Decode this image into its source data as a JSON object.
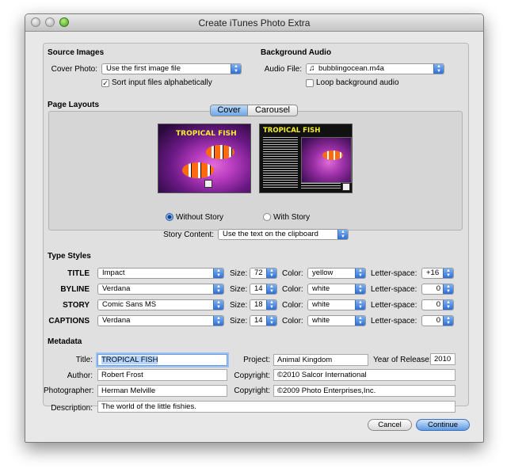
{
  "window": {
    "title": "Create iTunes Photo Extra"
  },
  "source_images": {
    "heading": "Source Images",
    "cover_photo_label": "Cover Photo:",
    "cover_photo_value": "Use the first image file",
    "sort_label": "Sort input files alphabetically",
    "sort_checked": true
  },
  "background_audio": {
    "heading": "Background Audio",
    "audio_file_label": "Audio File:",
    "audio_file_value": "bubblingocean.m4a",
    "loop_label": "Loop background audio",
    "loop_checked": false
  },
  "page_layouts": {
    "heading": "Page Layouts",
    "tabs": [
      "Cover",
      "Carousel"
    ],
    "selected_tab": "Cover",
    "preview_title": "TROPICAL FISH",
    "options": [
      {
        "label": "Without Story",
        "selected": true
      },
      {
        "label": "With Story",
        "selected": false
      }
    ],
    "story_content_label": "Story Content:",
    "story_content_value": "Use the text on the clipboard"
  },
  "type_styles": {
    "heading": "Type Styles",
    "size_label": "Size:",
    "color_label": "Color:",
    "letter_space_label": "Letter-space:",
    "rows": [
      {
        "name": "TITLE",
        "font": "Impact",
        "size": "72",
        "color": "yellow",
        "letter_space": "+16"
      },
      {
        "name": "BYLINE",
        "font": "Verdana",
        "size": "14",
        "color": "white",
        "letter_space": "0"
      },
      {
        "name": "STORY",
        "font": "Comic Sans MS",
        "size": "18",
        "color": "white",
        "letter_space": "0"
      },
      {
        "name": "CAPTIONS",
        "font": "Verdana",
        "size": "14",
        "color": "white",
        "letter_space": "0"
      }
    ]
  },
  "metadata": {
    "heading": "Metadata",
    "title_label": "Title:",
    "title_value": "TROPICAL FISH",
    "project_label": "Project:",
    "project_value": "Animal Kingdom",
    "year_label": "Year of Release:",
    "year_value": "2010",
    "author_label": "Author:",
    "author_value": "Robert Frost",
    "copyright_label": "Copyright:",
    "copyright_value": "©2010 Salcor International",
    "photographer_label": "Photographer:",
    "photographer_value": "Herman Melville",
    "copyright2_label": "Copyright:",
    "copyright2_value": "©2009 Photo Enterprises,Inc.",
    "description_label": "Description:",
    "description_value": "The world of the little fishies."
  },
  "buttons": {
    "cancel": "Cancel",
    "continue": "Continue"
  },
  "icons": {
    "popup_arrows": "updown-arrows-icon",
    "audio": "music-note-icon",
    "check": "checkmark-icon"
  },
  "colors": {
    "accent": "#3f7fde",
    "title_yellow": "#f4ee2b"
  }
}
